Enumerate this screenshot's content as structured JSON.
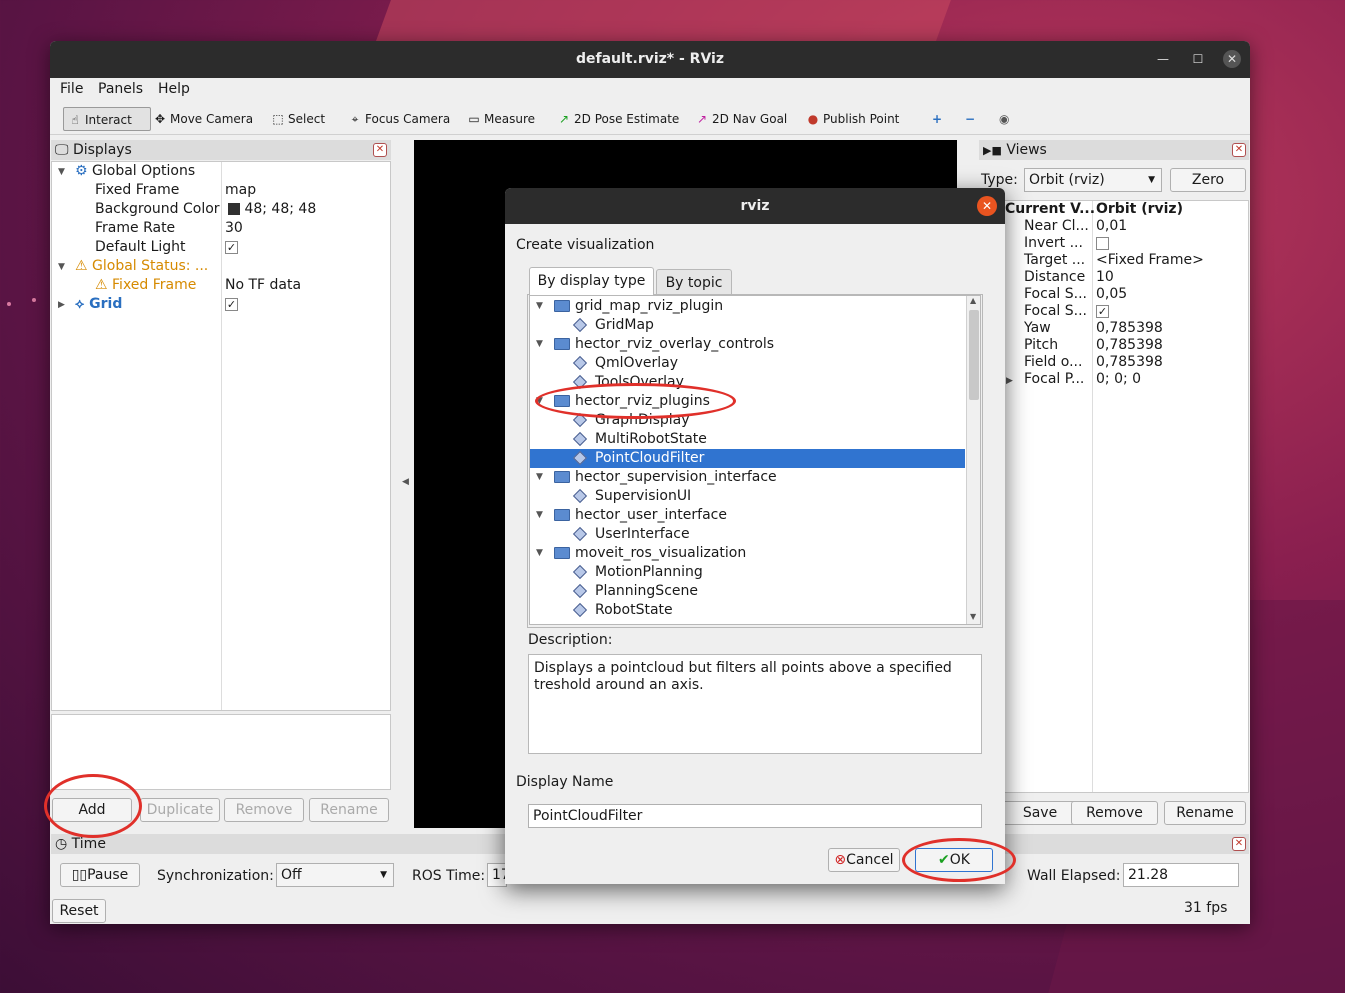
{
  "window": {
    "title": "default.rviz* - RViz",
    "min": "—",
    "max": "☐",
    "close": "✕"
  },
  "menu": [
    "File",
    "Panels",
    "Help"
  ],
  "toolbar": {
    "interact": "Interact",
    "move_camera": "Move Camera",
    "select": "Select",
    "focus_camera": "Focus Camera",
    "measure": "Measure",
    "pose_estimate": "2D Pose Estimate",
    "nav_goal": "2D Nav Goal",
    "publish_point": "Publish Point",
    "plus": "+",
    "minus": "−",
    "eye": "◉"
  },
  "displays": {
    "title": "Displays",
    "global_options": "Global Options",
    "fixed_frame_label": "Fixed Frame",
    "fixed_frame_value": "map",
    "bg_color_label": "Background Color",
    "bg_color_value": "48; 48; 48",
    "frame_rate_label": "Frame Rate",
    "frame_rate_value": "30",
    "default_light_label": "Default Light",
    "global_status_label": "Global Status: ...",
    "status_fixed_frame_label": "Fixed Frame",
    "status_fixed_frame_value": "No TF data",
    "grid_label": "Grid",
    "buttons": {
      "add": "Add",
      "duplicate": "Duplicate",
      "remove": "Remove",
      "rename": "Rename"
    }
  },
  "views": {
    "title": "Views",
    "type_label": "Type:",
    "type_value": "Orbit (rviz)",
    "zero": "Zero",
    "rows": [
      {
        "k": "Current V...",
        "v": "Orbit (rviz)"
      },
      {
        "k": "Near Cl...",
        "v": "0,01"
      },
      {
        "k": "Invert ...",
        "v": ""
      },
      {
        "k": "Target ...",
        "v": "<Fixed Frame>"
      },
      {
        "k": "Distance",
        "v": "10"
      },
      {
        "k": "Focal S...",
        "v": "0,05"
      },
      {
        "k": "Focal S...",
        "v": "✓"
      },
      {
        "k": "Yaw",
        "v": "0,785398"
      },
      {
        "k": "Pitch",
        "v": "0,785398"
      },
      {
        "k": "Field o...",
        "v": "0,785398"
      },
      {
        "k": "Focal P...",
        "v": "0; 0; 0"
      }
    ],
    "buttons": {
      "save": "Save",
      "remove": "Remove",
      "rename": "Rename"
    }
  },
  "time": {
    "title": "Time",
    "pause": "Pause",
    "sync_label": "Synchronization:",
    "sync_value": "Off",
    "ros_time_label": "ROS Time:",
    "ros_time_value": "17",
    "wall_elapsed_label": "Wall Elapsed:",
    "wall_elapsed_value": "21.28",
    "reset": "Reset",
    "fps": "31 fps"
  },
  "dialog": {
    "title": "rviz",
    "create_label": "Create visualization",
    "tab_display_type": "By display type",
    "tab_topic": "By topic",
    "items": [
      {
        "label": "grid_map_rviz_plugin",
        "kind": "folder"
      },
      {
        "label": "GridMap",
        "kind": "plugin"
      },
      {
        "label": "hector_rviz_overlay_controls",
        "kind": "folder"
      },
      {
        "label": "QmlOverlay",
        "kind": "plugin"
      },
      {
        "label": "ToolsOverlay",
        "kind": "plugin"
      },
      {
        "label": "hector_rviz_plugins",
        "kind": "folder"
      },
      {
        "label": "GraphDisplay",
        "kind": "plugin"
      },
      {
        "label": "MultiRobotState",
        "kind": "plugin"
      },
      {
        "label": "PointCloudFilter",
        "kind": "plugin",
        "selected": true
      },
      {
        "label": "hector_supervision_interface",
        "kind": "folder"
      },
      {
        "label": "SupervisionUI",
        "kind": "plugin"
      },
      {
        "label": "hector_user_interface",
        "kind": "folder"
      },
      {
        "label": "UserInterface",
        "kind": "plugin"
      },
      {
        "label": "moveit_ros_visualization",
        "kind": "folder"
      },
      {
        "label": "MotionPlanning",
        "kind": "plugin"
      },
      {
        "label": "PlanningScene",
        "kind": "plugin"
      },
      {
        "label": "RobotState",
        "kind": "plugin"
      }
    ],
    "description_label": "Description:",
    "description": "Displays a pointcloud but filters all points above a specified treshold around an axis.",
    "display_name_label": "Display Name",
    "display_name_value": "PointCloudFilter",
    "cancel": "Cancel",
    "ok": "OK"
  },
  "colors": {
    "selection": "#3074d0",
    "warning": "#d68a00",
    "grid_blue": "#2a6fc0",
    "annotation_red": "#e0302a"
  }
}
